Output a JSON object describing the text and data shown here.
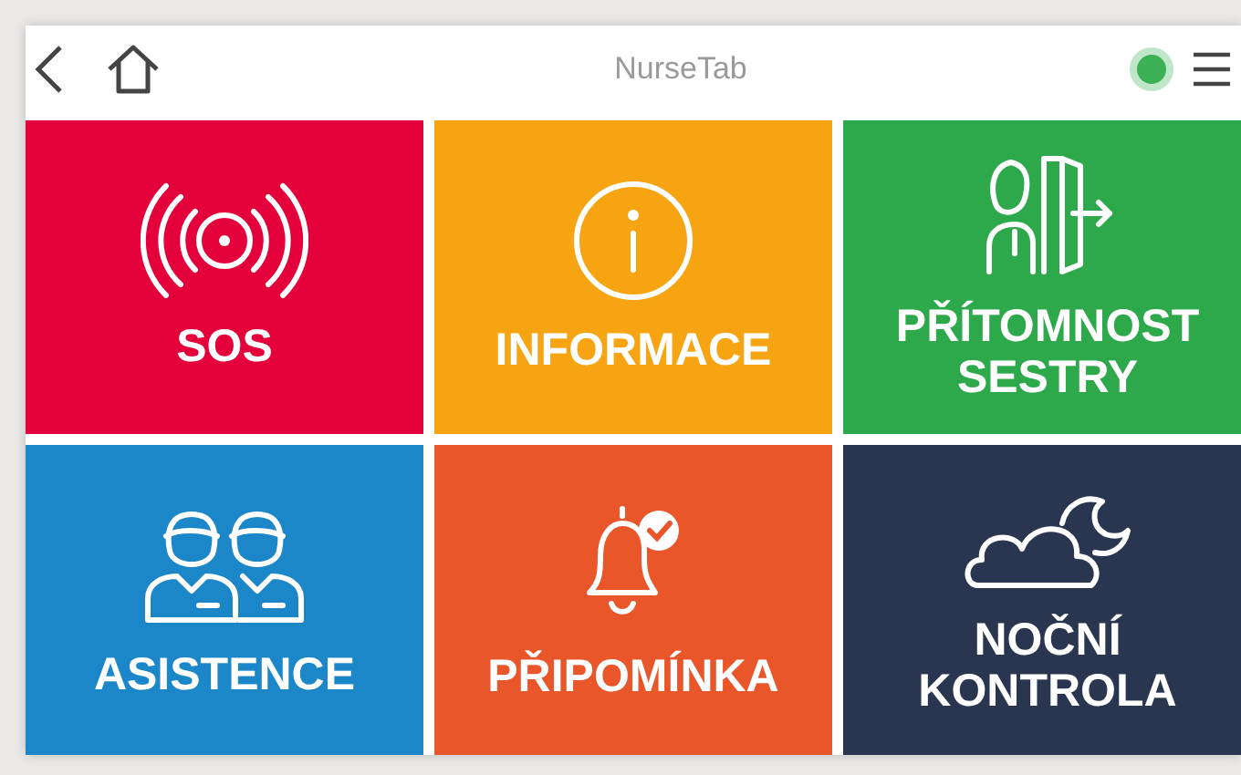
{
  "header": {
    "title": "NurseTab"
  },
  "tiles": [
    {
      "kind": "sos",
      "label_lines": [
        "SOS"
      ],
      "color": "#e4003a"
    },
    {
      "kind": "info",
      "label_lines": [
        "INFORMACE"
      ],
      "color": "#f6a412"
    },
    {
      "kind": "presence",
      "label_lines": [
        "PŘÍTOMNOST",
        "SESTRY"
      ],
      "color": "#2da84a"
    },
    {
      "kind": "assist",
      "label_lines": [
        "ASISTENCE"
      ],
      "color": "#1b87c9"
    },
    {
      "kind": "reminder",
      "label_lines": [
        "PŘIPOMÍNKA"
      ],
      "color": "#e8562a"
    },
    {
      "kind": "night",
      "label_lines": [
        "NOČNÍ",
        "KONTROLA"
      ],
      "color": "#2a3550"
    }
  ]
}
